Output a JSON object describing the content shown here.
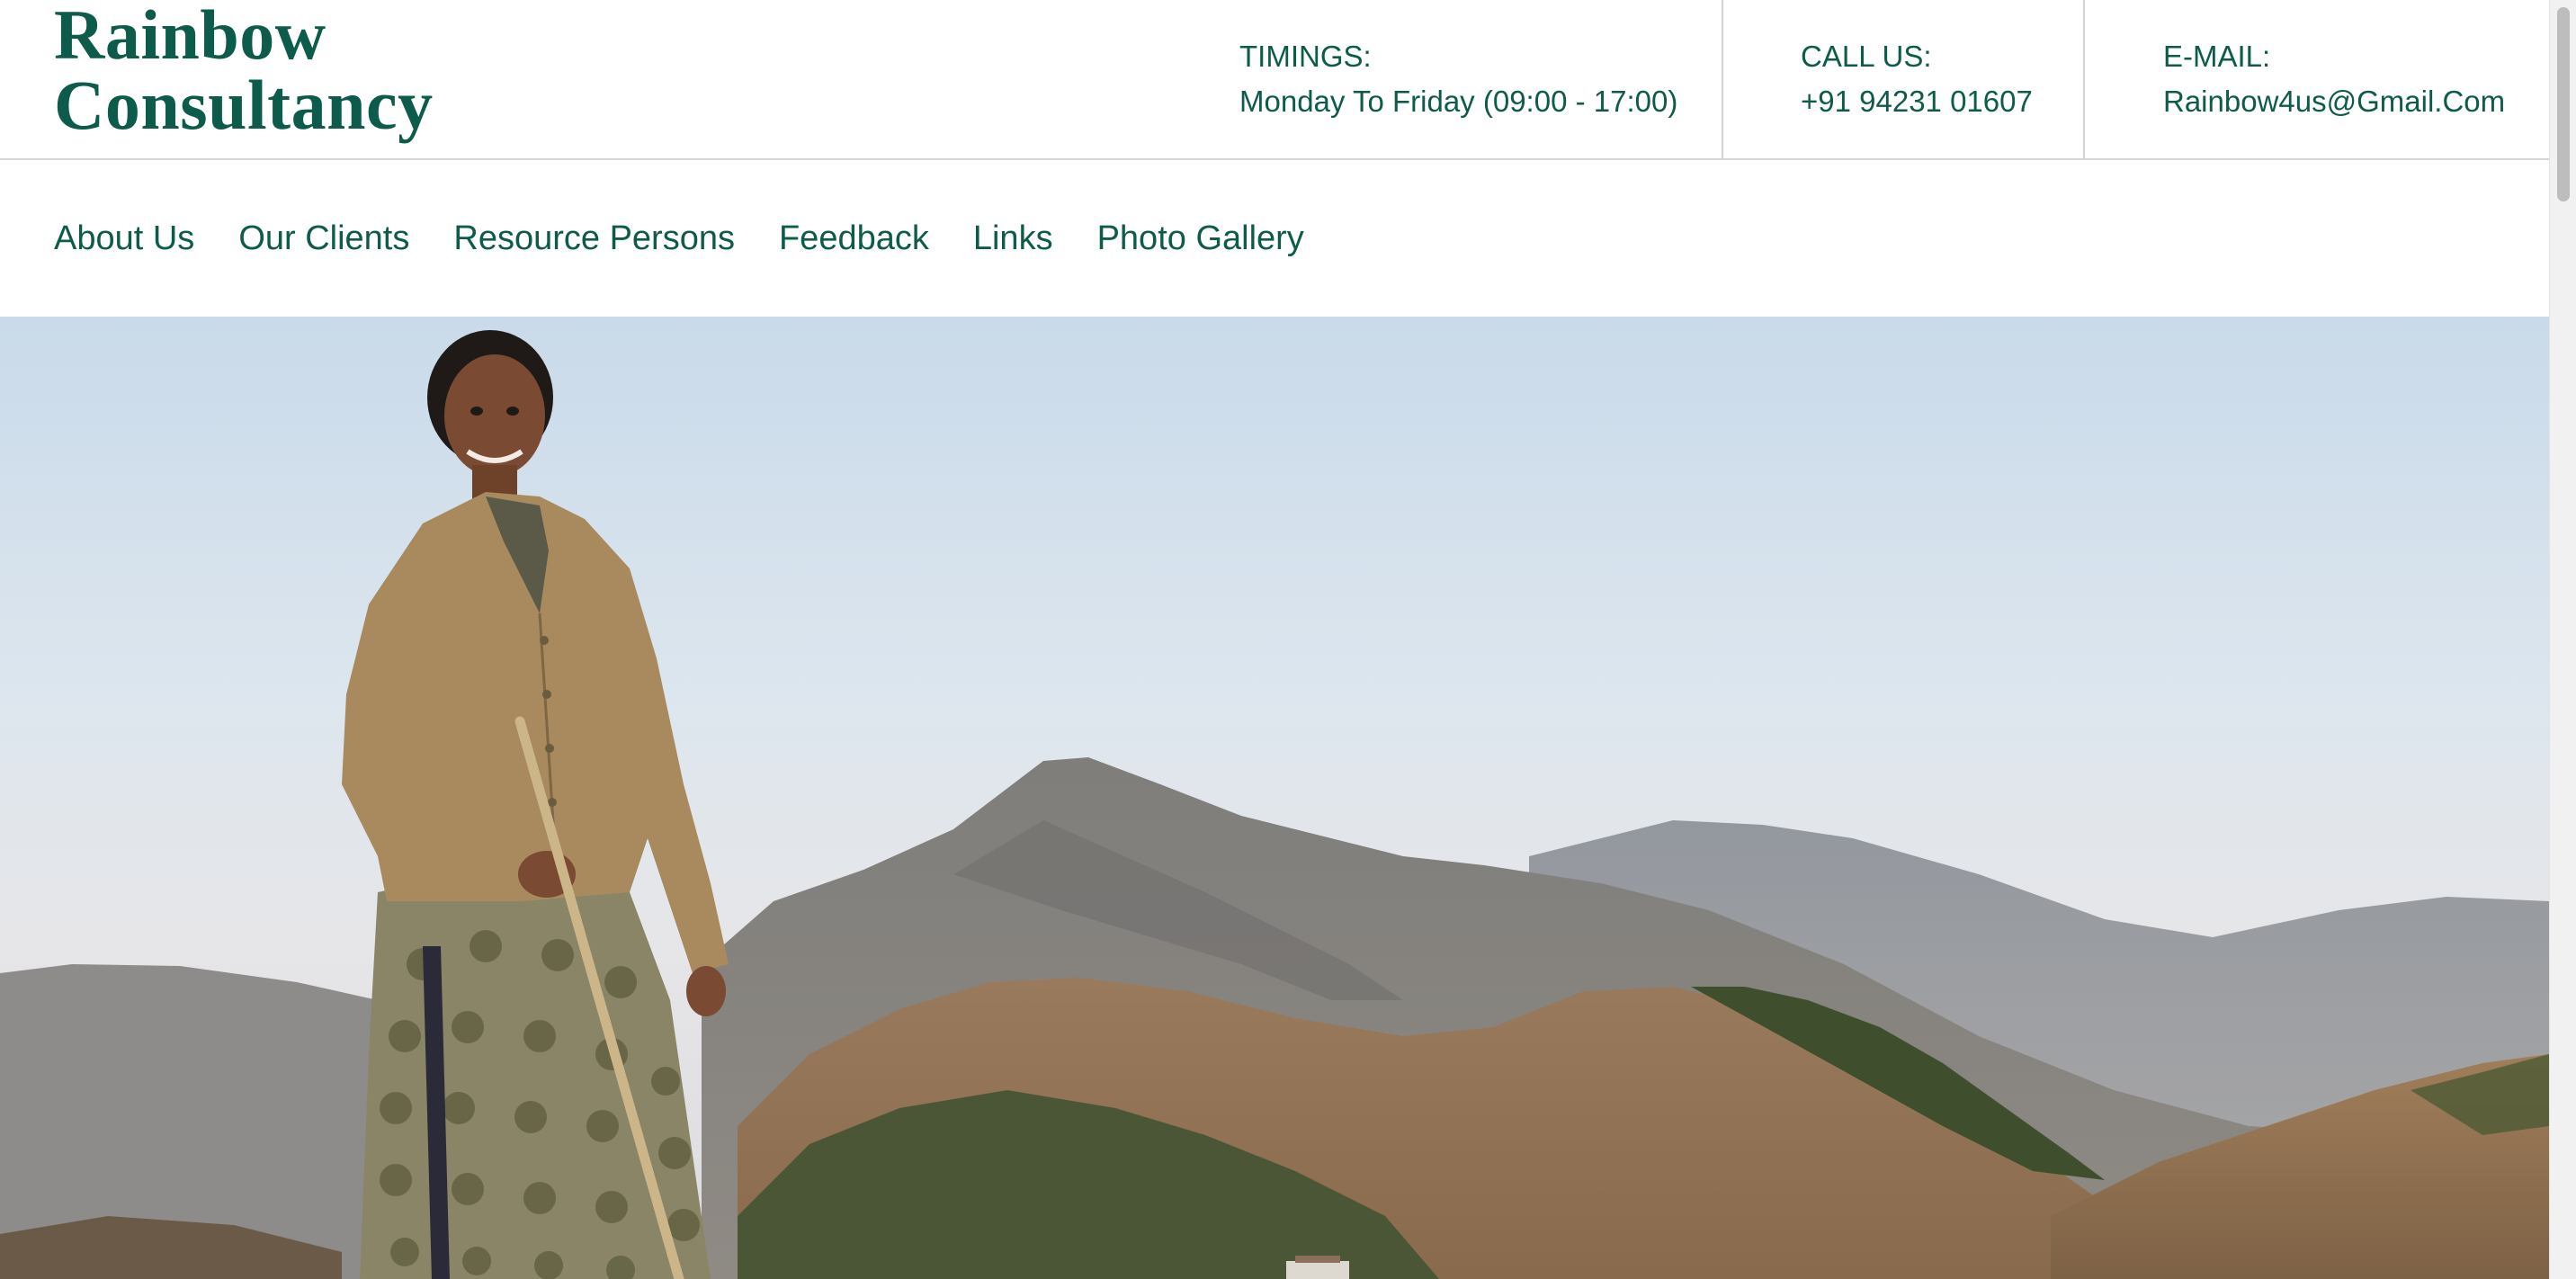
{
  "brand": {
    "line1": "Rainbow",
    "line2": "Consultancy"
  },
  "contact": {
    "timings_label": "TIMINGS:",
    "timings_value": "Monday To Friday (09:00 - 17:00)",
    "call_label": "CALL US:",
    "call_value": "+91 94231 01607",
    "email_label": "E-MAIL:",
    "email_value": "Rainbow4us@Gmail.Com"
  },
  "nav": {
    "items": [
      {
        "label": "About Us"
      },
      {
        "label": "Our Clients"
      },
      {
        "label": "Resource Persons"
      },
      {
        "label": "Feedback"
      },
      {
        "label": "Links"
      },
      {
        "label": "Photo Gallery"
      }
    ]
  },
  "colors": {
    "brand": "#0d5b4a",
    "divider": "#d4d4d4"
  }
}
